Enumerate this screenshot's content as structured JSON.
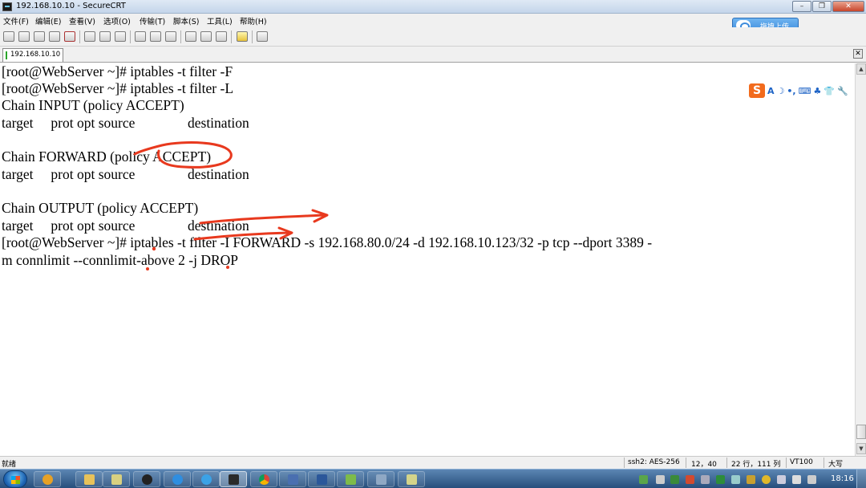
{
  "window": {
    "title": "192.168.10.10 - SecureCRT",
    "minimize": "–",
    "maximize": "❐",
    "close": "✕"
  },
  "menu": [
    "文件(F)",
    "编辑(E)",
    "查看(V)",
    "选项(O)",
    "传输(T)",
    "脚本(S)",
    "工具(L)",
    "帮助(H)"
  ],
  "upload_button": "拖拽上传",
  "session_tab": {
    "label": "192.168.10.10",
    "close": "✕"
  },
  "terminal": {
    "lines": [
      "[root@WebServer ~]# iptables -t filter -F",
      "[root@WebServer ~]# iptables -t filter -L",
      "Chain INPUT (policy ACCEPT)",
      "target     prot opt source               destination",
      "",
      "Chain FORWARD (policy ACCEPT)",
      "target     prot opt source               destination",
      "",
      "Chain OUTPUT (policy ACCEPT)",
      "target     prot opt source               destination",
      "[root@WebServer ~]# iptables -t filter -I FORWARD -s 192.168.80.0/24 -d 192.168.10.123/32 -p tcp --dport 3389 -",
      "m connlimit --connlimit-above 2 -j DROP"
    ]
  },
  "ime": {
    "logo": "S",
    "glyphs": [
      "A",
      "☽",
      "•,",
      "⌨",
      "♣",
      "👕",
      "🔧"
    ]
  },
  "status": {
    "ready": "就绪",
    "cipher": "ssh2: AES-256",
    "cursor": "12，40",
    "size": "22 行，111 列",
    "emulation": "VT100",
    "caps": "大写"
  },
  "taskbar": {
    "clock": "18:16"
  },
  "colors": {
    "annotation": "#e8391e",
    "taskbar": "#274e7c",
    "titlebar": "#c4d5ea"
  }
}
